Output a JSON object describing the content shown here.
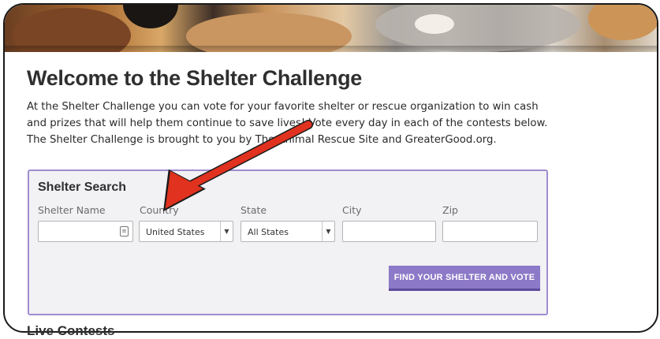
{
  "page": {
    "title": "Welcome to the Shelter Challenge",
    "intro": "At the Shelter Challenge you can vote for your favorite shelter or rescue organization to win cash and prizes that will help them continue to save lives! Vote every day in each of the contests below. The Shelter Challenge is brought to you by The Animal Rescue Site and GreaterGood.org.",
    "live_contests_heading": "Live Contests"
  },
  "search": {
    "title": "Shelter Search",
    "labels": {
      "shelter_name": "Shelter Name",
      "country": "Country",
      "state": "State",
      "city": "City",
      "zip": "Zip"
    },
    "values": {
      "shelter_name": "",
      "country": "United States",
      "state": "All States",
      "city": "",
      "zip": ""
    },
    "button_label": "FIND YOUR SHELTER AND VOTE"
  },
  "colors": {
    "accent": "#8c79c7",
    "annotation_arrow": "#e0321f"
  },
  "icons": {
    "contact_card": "contact-card-icon",
    "dropdown": "chevron-down-icon"
  }
}
